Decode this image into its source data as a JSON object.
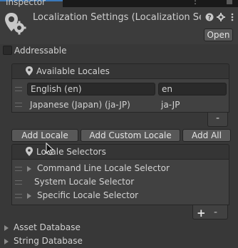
{
  "tab": {
    "label": "Inspector",
    "menu": "⋮"
  },
  "header": {
    "title": "Localization Settings (Localization Set",
    "help_icon": "help-icon",
    "settings_icon": "settings-icon",
    "menu_icon": "more-vert-icon",
    "open_label": "Open"
  },
  "addressable": {
    "label": "Addressable",
    "checked": false
  },
  "available_locales": {
    "title": "Available Locales",
    "rows": [
      {
        "name": "English (en)",
        "code": "en"
      },
      {
        "name": "Japanese (Japan) (ja-JP)",
        "code": "ja-JP"
      }
    ],
    "remove_label": "-"
  },
  "buttons": {
    "add_locale": "Add Locale",
    "add_custom_locale": "Add Custom Locale",
    "add_all": "Add All"
  },
  "locale_selectors": {
    "title": "Locale Selectors",
    "rows": [
      {
        "label": "Command Line Locale Selector",
        "expandable": true
      },
      {
        "label": "System Locale Selector",
        "expandable": false
      },
      {
        "label": "Specific Locale Selector",
        "expandable": true
      }
    ],
    "add_label": "+",
    "remove_label": "-"
  },
  "foldouts": {
    "asset_database": "Asset Database",
    "string_database": "String Database"
  },
  "colors": {
    "background": "#383838",
    "accent": "#3a79bb",
    "field": "#2a2a2a"
  }
}
